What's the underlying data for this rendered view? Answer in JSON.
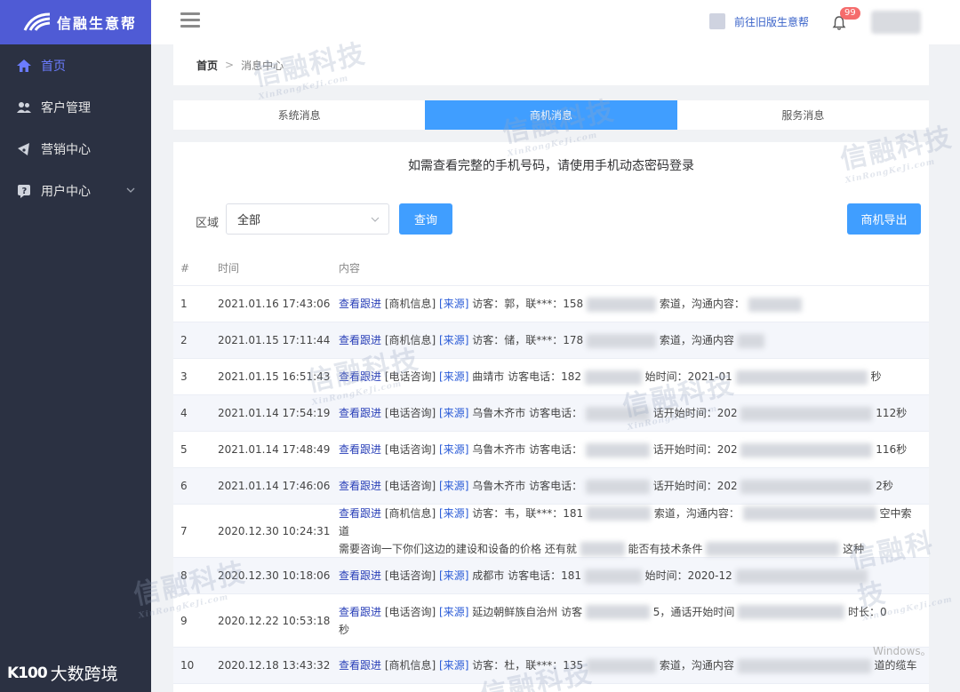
{
  "brand": {
    "name": "信融生意帮"
  },
  "sidebar": {
    "items": [
      {
        "label": "首页",
        "icon": "home-icon",
        "active": true
      },
      {
        "label": "客户管理",
        "icon": "users-icon"
      },
      {
        "label": "营销中心",
        "icon": "marketing-icon"
      },
      {
        "label": "用户中心",
        "icon": "user-center-icon",
        "expandable": true
      }
    ],
    "footer_logo": "大数跨境",
    "footer_mark": "K100"
  },
  "topbar": {
    "old_version_link": "前往旧版生意帮",
    "notification_count": "99"
  },
  "breadcrumb": {
    "home": "首页",
    "separator": ">",
    "current": "消息中心"
  },
  "tabs": [
    {
      "label": "系统消息",
      "active": false
    },
    {
      "label": "商机消息",
      "active": true
    },
    {
      "label": "服务消息",
      "active": false
    }
  ],
  "notice": "如需查看完整的手机号码，请使用手机动态密码登录",
  "filter": {
    "label": "区域",
    "selected": "全部",
    "query_button": "查询",
    "export_button": "商机导出"
  },
  "table": {
    "headers": {
      "idx": "#",
      "time": "时间",
      "content": "内容"
    },
    "follow_label": "查看跟进",
    "source_label": "[来源]",
    "rows": [
      {
        "idx": "1",
        "time": "2021.01.16 17:43:06",
        "type": "[商机信息]",
        "text": "访客：郭，联***：158",
        "mid": "索道，沟通内容：",
        "tail": ""
      },
      {
        "idx": "2",
        "time": "2021.01.15 17:11:44",
        "type": "[商机信息]",
        "text": "访客：储，联***：178",
        "mid": "索道，沟通内容",
        "tail": ""
      },
      {
        "idx": "3",
        "time": "2021.01.15 16:51:43",
        "type": "[电话咨询]",
        "text": "曲靖市 访客电话：182",
        "mid": "始时间：2021-01",
        "tail": "秒"
      },
      {
        "idx": "4",
        "time": "2021.01.14 17:54:19",
        "type": "[电话咨询]",
        "text": "乌鲁木齐市 访客电话：",
        "mid": "话开始时间：202",
        "tail": "112秒"
      },
      {
        "idx": "5",
        "time": "2021.01.14 17:48:49",
        "type": "[电话咨询]",
        "text": "乌鲁木齐市 访客电话：",
        "mid": "话开始时间：202",
        "tail": "116秒"
      },
      {
        "idx": "6",
        "time": "2021.01.14 17:46:06",
        "type": "[电话咨询]",
        "text": "乌鲁木齐市 访客电话：",
        "mid": "话开始时间：202",
        "tail": "2秒"
      },
      {
        "idx": "7",
        "time": "2020.12.30 10:24:31",
        "type": "[商机信息]",
        "text": "访客：韦，联***：181",
        "mid": "索道，沟通内容：",
        "tail": "空中索道",
        "line2": "需要咨询一下你们这边的建设和设备的价格 还有就",
        "line2_mid": "能否有技术条件",
        "line2_tail": "这种"
      },
      {
        "idx": "8",
        "time": "2020.12.30 10:18:06",
        "type": "[电话咨询]",
        "text": "成都市 访客电话：181",
        "mid": "始时间：2020-12",
        "tail": ""
      },
      {
        "idx": "9",
        "time": "2020.12.22 10:53:18",
        "type": "[电话咨询]",
        "text": "延边朝鲜族自治州 访客",
        "mid": "5，通话开始时间",
        "tail": "时长：0",
        "line2": "秒"
      },
      {
        "idx": "10",
        "time": "2020.12.18 13:43:32",
        "type": "[商机信息]",
        "text": "访客：杜，联***：135",
        "mid": "索道，沟通内容",
        "tail": "道的缆车"
      }
    ]
  },
  "watermark": {
    "text": "信融科技",
    "sub": "XinRongKeJi.com"
  },
  "os_watermark": "Windows。"
}
